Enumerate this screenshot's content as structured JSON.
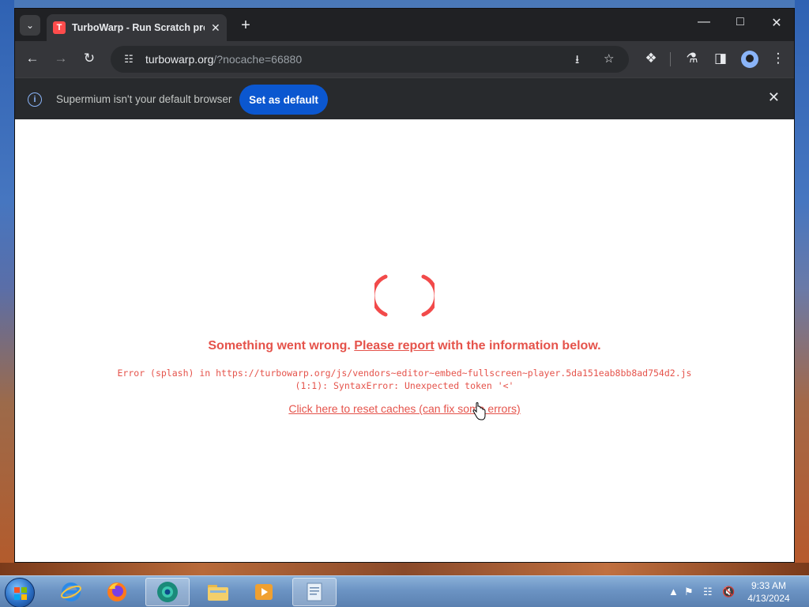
{
  "browser": {
    "tab": {
      "title": "TurboWarp - Run Scratch proje",
      "favicon": "turbowarp-icon"
    },
    "new_tab_label": "+",
    "window_controls": [
      "minimize",
      "maximize",
      "close"
    ],
    "address_bar": {
      "host": "turbowarp.org",
      "path": "/?nocache=66880"
    },
    "infobar": {
      "message": "Supermium isn't your default browser",
      "button_label": "Set as default"
    }
  },
  "page": {
    "error_heading_prefix": "Something went wrong. ",
    "error_heading_link": "Please report",
    "error_heading_suffix": " with the information below.",
    "error_detail_line1": "Error (splash) in https://turbowarp.org/js/vendors~editor~embed~fullscreen~player.5da151eab8bb8ad754d2.js",
    "error_detail_line2": "(1:1): SyntaxError: Unexpected token '<'",
    "reset_link": "Click here to reset caches (can fix some errors)",
    "accent_color": "#e5534b"
  },
  "taskbar": {
    "apps": [
      "internet-explorer",
      "firefox",
      "supermium",
      "file-explorer",
      "media-player",
      "notepad"
    ],
    "clock_time": "9:33 AM",
    "clock_date": "4/13/2024"
  }
}
